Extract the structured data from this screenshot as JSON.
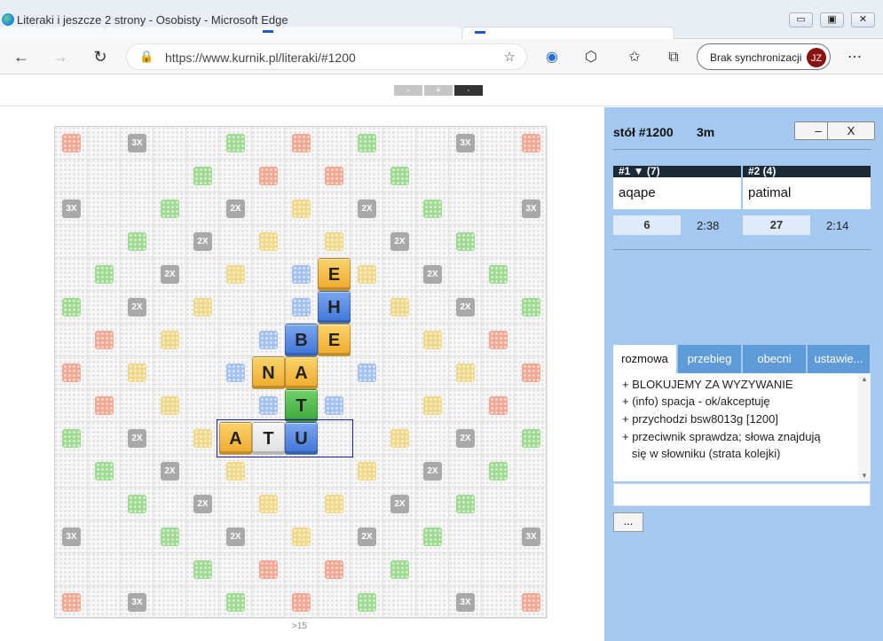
{
  "window": {
    "title": "Literaki i jeszcze 2 strony - Osobisty - Microsoft Edge",
    "min_label": "▭",
    "max_label": "▣",
    "close_label": "✕"
  },
  "address": {
    "url": "https://www.kurnik.pl/literaki/#1200",
    "sync_label": "Brak synchronizacji",
    "avatar_initials": "JZ"
  },
  "zoom": {
    "minus": "-",
    "plus": "+",
    "dot": "·"
  },
  "board": {
    "premium_squares": [
      {
        "r": 0,
        "c": 0,
        "k": "word3"
      },
      {
        "r": 0,
        "c": 2,
        "k": "txt",
        "t": "3X"
      },
      {
        "r": 0,
        "c": 5,
        "k": "let3"
      },
      {
        "r": 0,
        "c": 7,
        "k": "word3"
      },
      {
        "r": 0,
        "c": 9,
        "k": "let3"
      },
      {
        "r": 0,
        "c": 12,
        "k": "txt",
        "t": "3X"
      },
      {
        "r": 0,
        "c": 14,
        "k": "word3"
      },
      {
        "r": 1,
        "c": 4,
        "k": "let3"
      },
      {
        "r": 1,
        "c": 6,
        "k": "word3"
      },
      {
        "r": 1,
        "c": 8,
        "k": "word3"
      },
      {
        "r": 1,
        "c": 10,
        "k": "let3"
      },
      {
        "r": 2,
        "c": 0,
        "k": "txt",
        "t": "3X"
      },
      {
        "r": 2,
        "c": 3,
        "k": "let3"
      },
      {
        "r": 2,
        "c": 5,
        "k": "txt",
        "t": "2X"
      },
      {
        "r": 2,
        "c": 7,
        "k": "word2"
      },
      {
        "r": 2,
        "c": 9,
        "k": "txt",
        "t": "2X"
      },
      {
        "r": 2,
        "c": 11,
        "k": "let3"
      },
      {
        "r": 2,
        "c": 14,
        "k": "txt",
        "t": "3X"
      },
      {
        "r": 3,
        "c": 2,
        "k": "let3"
      },
      {
        "r": 3,
        "c": 4,
        "k": "txt",
        "t": "2X"
      },
      {
        "r": 3,
        "c": 6,
        "k": "word2"
      },
      {
        "r": 3,
        "c": 8,
        "k": "word2"
      },
      {
        "r": 3,
        "c": 10,
        "k": "txt",
        "t": "2X"
      },
      {
        "r": 3,
        "c": 12,
        "k": "let3"
      },
      {
        "r": 4,
        "c": 1,
        "k": "let3"
      },
      {
        "r": 4,
        "c": 3,
        "k": "txt",
        "t": "2X"
      },
      {
        "r": 4,
        "c": 5,
        "k": "word2"
      },
      {
        "r": 4,
        "c": 7,
        "k": "let2"
      },
      {
        "r": 4,
        "c": 9,
        "k": "word2"
      },
      {
        "r": 4,
        "c": 11,
        "k": "txt",
        "t": "2X"
      },
      {
        "r": 4,
        "c": 13,
        "k": "let3"
      },
      {
        "r": 5,
        "c": 0,
        "k": "let3"
      },
      {
        "r": 5,
        "c": 2,
        "k": "txt",
        "t": "2X"
      },
      {
        "r": 5,
        "c": 4,
        "k": "word2"
      },
      {
        "r": 5,
        "c": 7,
        "k": "let2"
      },
      {
        "r": 5,
        "c": 10,
        "k": "word2"
      },
      {
        "r": 5,
        "c": 12,
        "k": "txt",
        "t": "2X"
      },
      {
        "r": 5,
        "c": 14,
        "k": "let3"
      },
      {
        "r": 6,
        "c": 1,
        "k": "word3"
      },
      {
        "r": 6,
        "c": 3,
        "k": "word2"
      },
      {
        "r": 6,
        "c": 6,
        "k": "let2"
      },
      {
        "r": 6,
        "c": 11,
        "k": "word2"
      },
      {
        "r": 6,
        "c": 13,
        "k": "word3"
      },
      {
        "r": 7,
        "c": 0,
        "k": "word3"
      },
      {
        "r": 7,
        "c": 2,
        "k": "word2"
      },
      {
        "r": 7,
        "c": 5,
        "k": "let2"
      },
      {
        "r": 7,
        "c": 9,
        "k": "let2"
      },
      {
        "r": 7,
        "c": 12,
        "k": "word2"
      },
      {
        "r": 7,
        "c": 14,
        "k": "word3"
      },
      {
        "r": 8,
        "c": 1,
        "k": "word3"
      },
      {
        "r": 8,
        "c": 3,
        "k": "word2"
      },
      {
        "r": 8,
        "c": 6,
        "k": "let2"
      },
      {
        "r": 8,
        "c": 8,
        "k": "let2"
      },
      {
        "r": 8,
        "c": 11,
        "k": "word2"
      },
      {
        "r": 8,
        "c": 13,
        "k": "word3"
      },
      {
        "r": 9,
        "c": 0,
        "k": "let3"
      },
      {
        "r": 9,
        "c": 2,
        "k": "txt",
        "t": "2X"
      },
      {
        "r": 9,
        "c": 4,
        "k": "word2"
      },
      {
        "r": 9,
        "c": 10,
        "k": "word2"
      },
      {
        "r": 9,
        "c": 12,
        "k": "txt",
        "t": "2X"
      },
      {
        "r": 9,
        "c": 14,
        "k": "let3"
      },
      {
        "r": 10,
        "c": 1,
        "k": "let3"
      },
      {
        "r": 10,
        "c": 3,
        "k": "txt",
        "t": "2X"
      },
      {
        "r": 10,
        "c": 5,
        "k": "word2"
      },
      {
        "r": 10,
        "c": 9,
        "k": "word2"
      },
      {
        "r": 10,
        "c": 11,
        "k": "txt",
        "t": "2X"
      },
      {
        "r": 10,
        "c": 13,
        "k": "let3"
      },
      {
        "r": 11,
        "c": 2,
        "k": "let3"
      },
      {
        "r": 11,
        "c": 4,
        "k": "txt",
        "t": "2X"
      },
      {
        "r": 11,
        "c": 6,
        "k": "word2"
      },
      {
        "r": 11,
        "c": 8,
        "k": "word2"
      },
      {
        "r": 11,
        "c": 10,
        "k": "txt",
        "t": "2X"
      },
      {
        "r": 11,
        "c": 12,
        "k": "let3"
      },
      {
        "r": 12,
        "c": 0,
        "k": "txt",
        "t": "3X"
      },
      {
        "r": 12,
        "c": 3,
        "k": "let3"
      },
      {
        "r": 12,
        "c": 5,
        "k": "txt",
        "t": "2X"
      },
      {
        "r": 12,
        "c": 7,
        "k": "word2"
      },
      {
        "r": 12,
        "c": 9,
        "k": "txt",
        "t": "2X"
      },
      {
        "r": 12,
        "c": 11,
        "k": "let3"
      },
      {
        "r": 12,
        "c": 14,
        "k": "txt",
        "t": "3X"
      },
      {
        "r": 13,
        "c": 4,
        "k": "let3"
      },
      {
        "r": 13,
        "c": 6,
        "k": "word3"
      },
      {
        "r": 13,
        "c": 8,
        "k": "word3"
      },
      {
        "r": 13,
        "c": 10,
        "k": "let3"
      },
      {
        "r": 14,
        "c": 0,
        "k": "word3"
      },
      {
        "r": 14,
        "c": 2,
        "k": "txt",
        "t": "3X"
      },
      {
        "r": 14,
        "c": 5,
        "k": "let3"
      },
      {
        "r": 14,
        "c": 7,
        "k": "word3"
      },
      {
        "r": 14,
        "c": 9,
        "k": "let3"
      },
      {
        "r": 14,
        "c": 12,
        "k": "txt",
        "t": "3X"
      },
      {
        "r": 14,
        "c": 14,
        "k": "word3"
      }
    ],
    "tiles": [
      {
        "r": 4,
        "c": 8,
        "letter": "E",
        "color": "yellow"
      },
      {
        "r": 5,
        "c": 8,
        "letter": "H",
        "color": "blue"
      },
      {
        "r": 6,
        "c": 7,
        "letter": "B",
        "color": "blue"
      },
      {
        "r": 6,
        "c": 8,
        "letter": "E",
        "color": "yellow"
      },
      {
        "r": 7,
        "c": 6,
        "letter": "N",
        "color": "yellow"
      },
      {
        "r": 7,
        "c": 7,
        "letter": "A",
        "color": "yellow"
      },
      {
        "r": 8,
        "c": 7,
        "letter": "T",
        "color": "green"
      },
      {
        "r": 9,
        "c": 5,
        "letter": "A",
        "color": "yellow"
      },
      {
        "r": 9,
        "c": 6,
        "letter": "T",
        "color": "white"
      },
      {
        "r": 9,
        "c": 7,
        "letter": "U",
        "color": "blue"
      }
    ],
    "footer_note": ">15"
  },
  "panel": {
    "table_label": "stół #1200",
    "time_label": "3m",
    "minimize_label": "–",
    "close_label": "X",
    "players": [
      {
        "header": "#1 ▼ (7)",
        "name": "aqape",
        "score": "6",
        "clock": "2:38"
      },
      {
        "header": "#2   (4)",
        "name": "patimal",
        "score": "27",
        "clock": "2:14"
      }
    ],
    "tabs": [
      "rozmowa",
      "przebieg",
      "obecni",
      "ustawie..."
    ],
    "chat": [
      "+ BLOKUJEMY ZA WYZYWANIE",
      "+ (info) spacja - ok/akceptuję",
      "+ przychodzi bsw8013g [1200]",
      "+ przeciwnik sprawdza; słowa znajdują",
      "   się w słowniku (strata kolejki)"
    ],
    "more_label": "..."
  }
}
